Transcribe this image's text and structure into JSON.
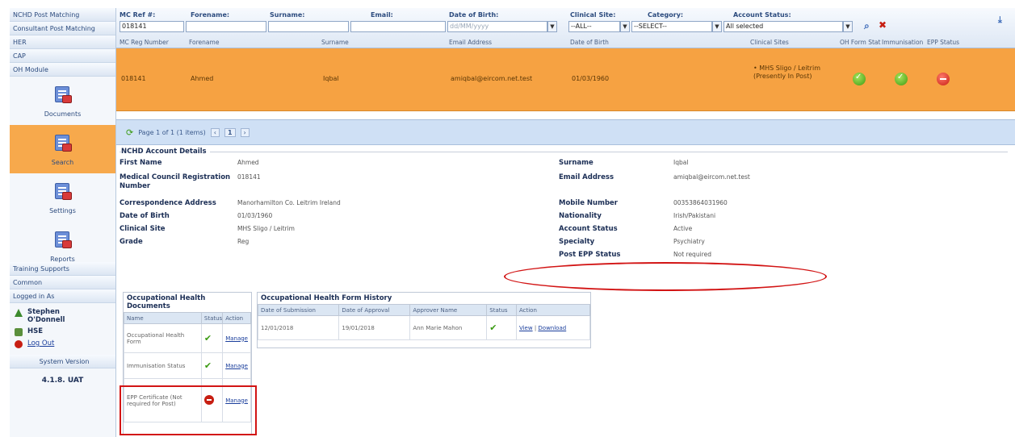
{
  "sidebar": {
    "top_links": [
      "NCHD Post Matching",
      "Consultant Post Matching",
      "HER",
      "CAP",
      "OH Module"
    ],
    "modules": [
      {
        "label": "Documents",
        "active": false
      },
      {
        "label": "Search",
        "active": true
      },
      {
        "label": "Settings",
        "active": false
      },
      {
        "label": "Reports",
        "active": false
      }
    ],
    "bottom_links": [
      "Training Supports",
      "Common",
      "Logged in As"
    ],
    "user_name": "Stephen O'Donnell",
    "org": "HSE",
    "logout": "Log Out",
    "system_version_label": "System Version",
    "version": "4.1.8. UAT"
  },
  "filters": {
    "mc_ref_label": "MC Ref #:",
    "mc_ref_value": "018141",
    "forename_label": "Forename:",
    "surname_label": "Surname:",
    "email_label": "Email:",
    "dob_label": "Date of Birth:",
    "dob_placeholder": "dd/MM/yyyy",
    "site_label": "Clinical Site:",
    "site_value": "--ALL--",
    "category_label": "Category:",
    "category_value": "--SELECT--",
    "status_label": "Account Status:",
    "status_value": "All selected"
  },
  "columns": [
    "MC Reg Number",
    "Forename",
    "Surname",
    "Email Address",
    "Date of Birth",
    "Clinical Sites",
    "OH Form Stat",
    "Immunisation",
    "EPP Status"
  ],
  "result": {
    "mc_reg": "018141",
    "forename": "Ahmed",
    "surname": "Iqbal",
    "email": "amiqbal@eircom.net.test",
    "dob": "01/03/1960",
    "site": "• MHS Sligo / Leitrim (Presently In Post)"
  },
  "pager": {
    "text": "Page 1 of 1 (1 items)",
    "current_page": "1"
  },
  "account": {
    "title": "NCHD Account Details",
    "left": [
      {
        "label": "First Name",
        "value": "Ahmed"
      },
      {
        "label": "Medical Council Registration Number",
        "value": "018141"
      },
      {
        "label": "Correspondence Address",
        "value": "Manorhamilton Co. Leitrim Ireland"
      },
      {
        "label": "Date of Birth",
        "value": "01/03/1960"
      },
      {
        "label": "Clinical Site",
        "value": "MHS Sligo / Leitrim"
      },
      {
        "label": "Grade",
        "value": "Reg"
      }
    ],
    "right": [
      {
        "label": "Surname",
        "value": "Iqbal"
      },
      {
        "label": "Email Address",
        "value": "amiqbal@eircom.net.test"
      },
      {
        "label": "Mobile Number",
        "value": "00353864031960"
      },
      {
        "label": "Nationality",
        "value": "Irish/Pakistani"
      },
      {
        "label": "Account Status",
        "value": "Active"
      },
      {
        "label": "Specialty",
        "value": "Psychiatry"
      },
      {
        "label": "Post EPP Status",
        "value": "Not required"
      }
    ]
  },
  "oh_docs": {
    "title": "Occupational Health Documents",
    "headers": [
      "Name",
      "Status",
      "Action"
    ],
    "rows": [
      {
        "name": "Occupational Health Form",
        "status": "ok",
        "action": "Manage"
      },
      {
        "name": "Immunisation Status",
        "status": "ok",
        "action": "Manage"
      },
      {
        "name": "EPP Certificate (Not required for Post)",
        "status": "no",
        "action": "Manage"
      }
    ]
  },
  "oh_history": {
    "title": "Occupational Health Form History",
    "headers": [
      "Date of Submission",
      "Date of Approval",
      "Approver Name",
      "Status",
      "Action"
    ],
    "row": {
      "submitted": "12/01/2018",
      "approved": "19/01/2018",
      "approver": "Ann Marie Mahon",
      "view": "View",
      "download": "Download"
    }
  },
  "colors": {
    "accent": "#f6a242",
    "header_bg": "#dde7f4",
    "annotation_red": "#d21414"
  }
}
